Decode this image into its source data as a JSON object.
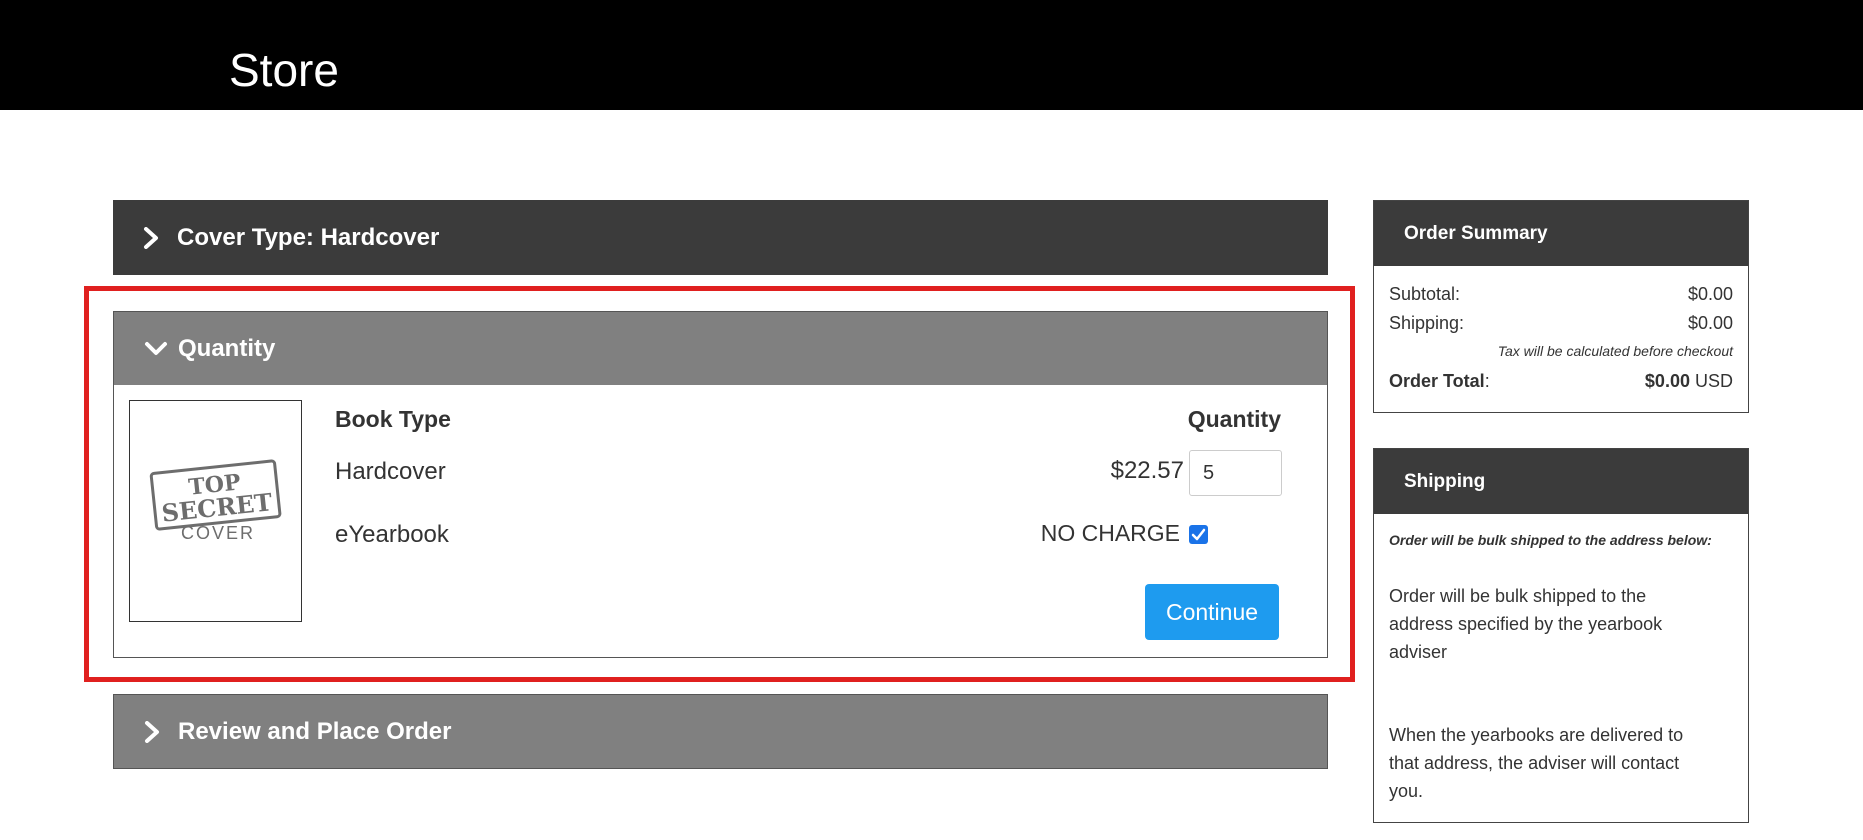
{
  "header": {
    "title": "Store"
  },
  "sections": {
    "cover": {
      "label": "Cover Type: Hardcover"
    },
    "quantity": {
      "label": "Quantity"
    },
    "review": {
      "label": "Review and Place Order"
    }
  },
  "quantity_panel": {
    "cover_image": {
      "line1": "TOP",
      "line2": "SECRET",
      "line3": "COVER"
    },
    "col_book_type": "Book Type",
    "col_quantity": "Quantity",
    "rows": [
      {
        "label": "Hardcover",
        "price": "$22.57",
        "quantity": "5"
      },
      {
        "label": "eYearbook",
        "price": "NO CHARGE",
        "checked": true
      }
    ],
    "continue_label": "Continue"
  },
  "order_summary": {
    "title": "Order Summary",
    "subtotal_label": "Subtotal:",
    "subtotal_value": "$0.00",
    "shipping_label": "Shipping:",
    "shipping_value": "$0.00",
    "tax_note": "Tax will be calculated before checkout",
    "total_label": "Order Total",
    "total_colon": ":",
    "total_value": "$0.00",
    "total_currency": "USD"
  },
  "shipping": {
    "title": "Shipping",
    "note": "Order will be bulk shipped to the address below:",
    "paragraph1": "Order will be bulk shipped to the address specified by the yearbook adviser",
    "paragraph2": "When the yearbooks are delivered to that address, the adviser will contact you."
  },
  "colors": {
    "topbar": "#000000",
    "dark_header": "#3b3b3b",
    "grey_header": "#808080",
    "highlight": "#e0201f",
    "button": "#1e9bef"
  }
}
